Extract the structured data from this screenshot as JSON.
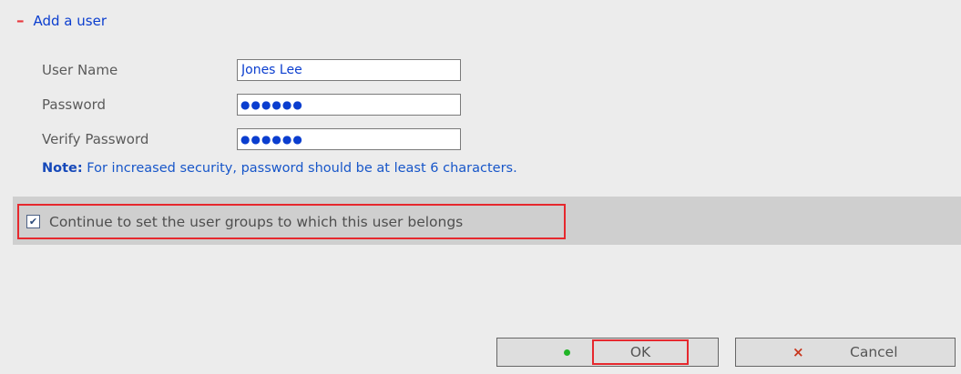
{
  "section": {
    "collapse_symbol": "–",
    "title": "Add a user"
  },
  "form": {
    "username_label": "User Name",
    "username_value": "Jones Lee",
    "password_label": "Password",
    "password_mask": "●●●●●●",
    "verify_label": "Verify Password",
    "verify_mask": "●●●●●●"
  },
  "note": {
    "prefix": "Note:",
    "text": " For increased security, password should be at least 6 characters."
  },
  "groups_option": {
    "checked": true,
    "check_glyph": "✔",
    "label": "Continue to set the user groups to which this user belongs"
  },
  "buttons": {
    "ok_label": "OK",
    "cancel_symbol": "×",
    "cancel_label": "Cancel"
  },
  "colors": {
    "highlight": "#e6282e",
    "accent_blue": "#0b3ecf",
    "ok_green": "#21b527",
    "cancel_red": "#c8361d"
  }
}
